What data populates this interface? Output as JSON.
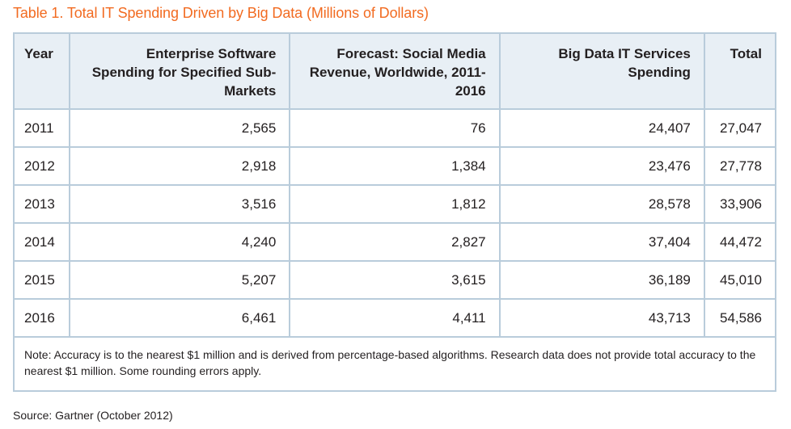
{
  "title": "Table 1. Total IT Spending Driven by Big Data (Millions of Dollars)",
  "table": {
    "headers": [
      "Year",
      "Enterprise Software Spending for Specified Sub-Markets",
      "Forecast: Social Media Revenue, Worldwide, 2011-2016",
      "Big Data IT Services Spending",
      "Total"
    ],
    "rows": [
      [
        "2011",
        "2,565",
        "76",
        "24,407",
        "27,047"
      ],
      [
        "2012",
        "2,918",
        "1,384",
        "23,476",
        "27,778"
      ],
      [
        "2013",
        "3,516",
        "1,812",
        "28,578",
        "33,906"
      ],
      [
        "2014",
        "4,240",
        "2,827",
        "37,404",
        "44,472"
      ],
      [
        "2015",
        "5,207",
        "3,615",
        "36,189",
        "45,010"
      ],
      [
        "2016",
        "6,461",
        "4,411",
        "43,713",
        "54,586"
      ]
    ],
    "note": "Note: Accuracy is to the nearest $1 million and is derived from percentage-based algorithms. Research data does not provide total accuracy to the nearest $1 million. Some rounding errors apply."
  },
  "source": "Source: Gartner (October 2012)",
  "colors": {
    "title": "#f26b21",
    "header_bg": "#e8eff5",
    "border": "#b9ccdb",
    "text": "#231f20"
  }
}
